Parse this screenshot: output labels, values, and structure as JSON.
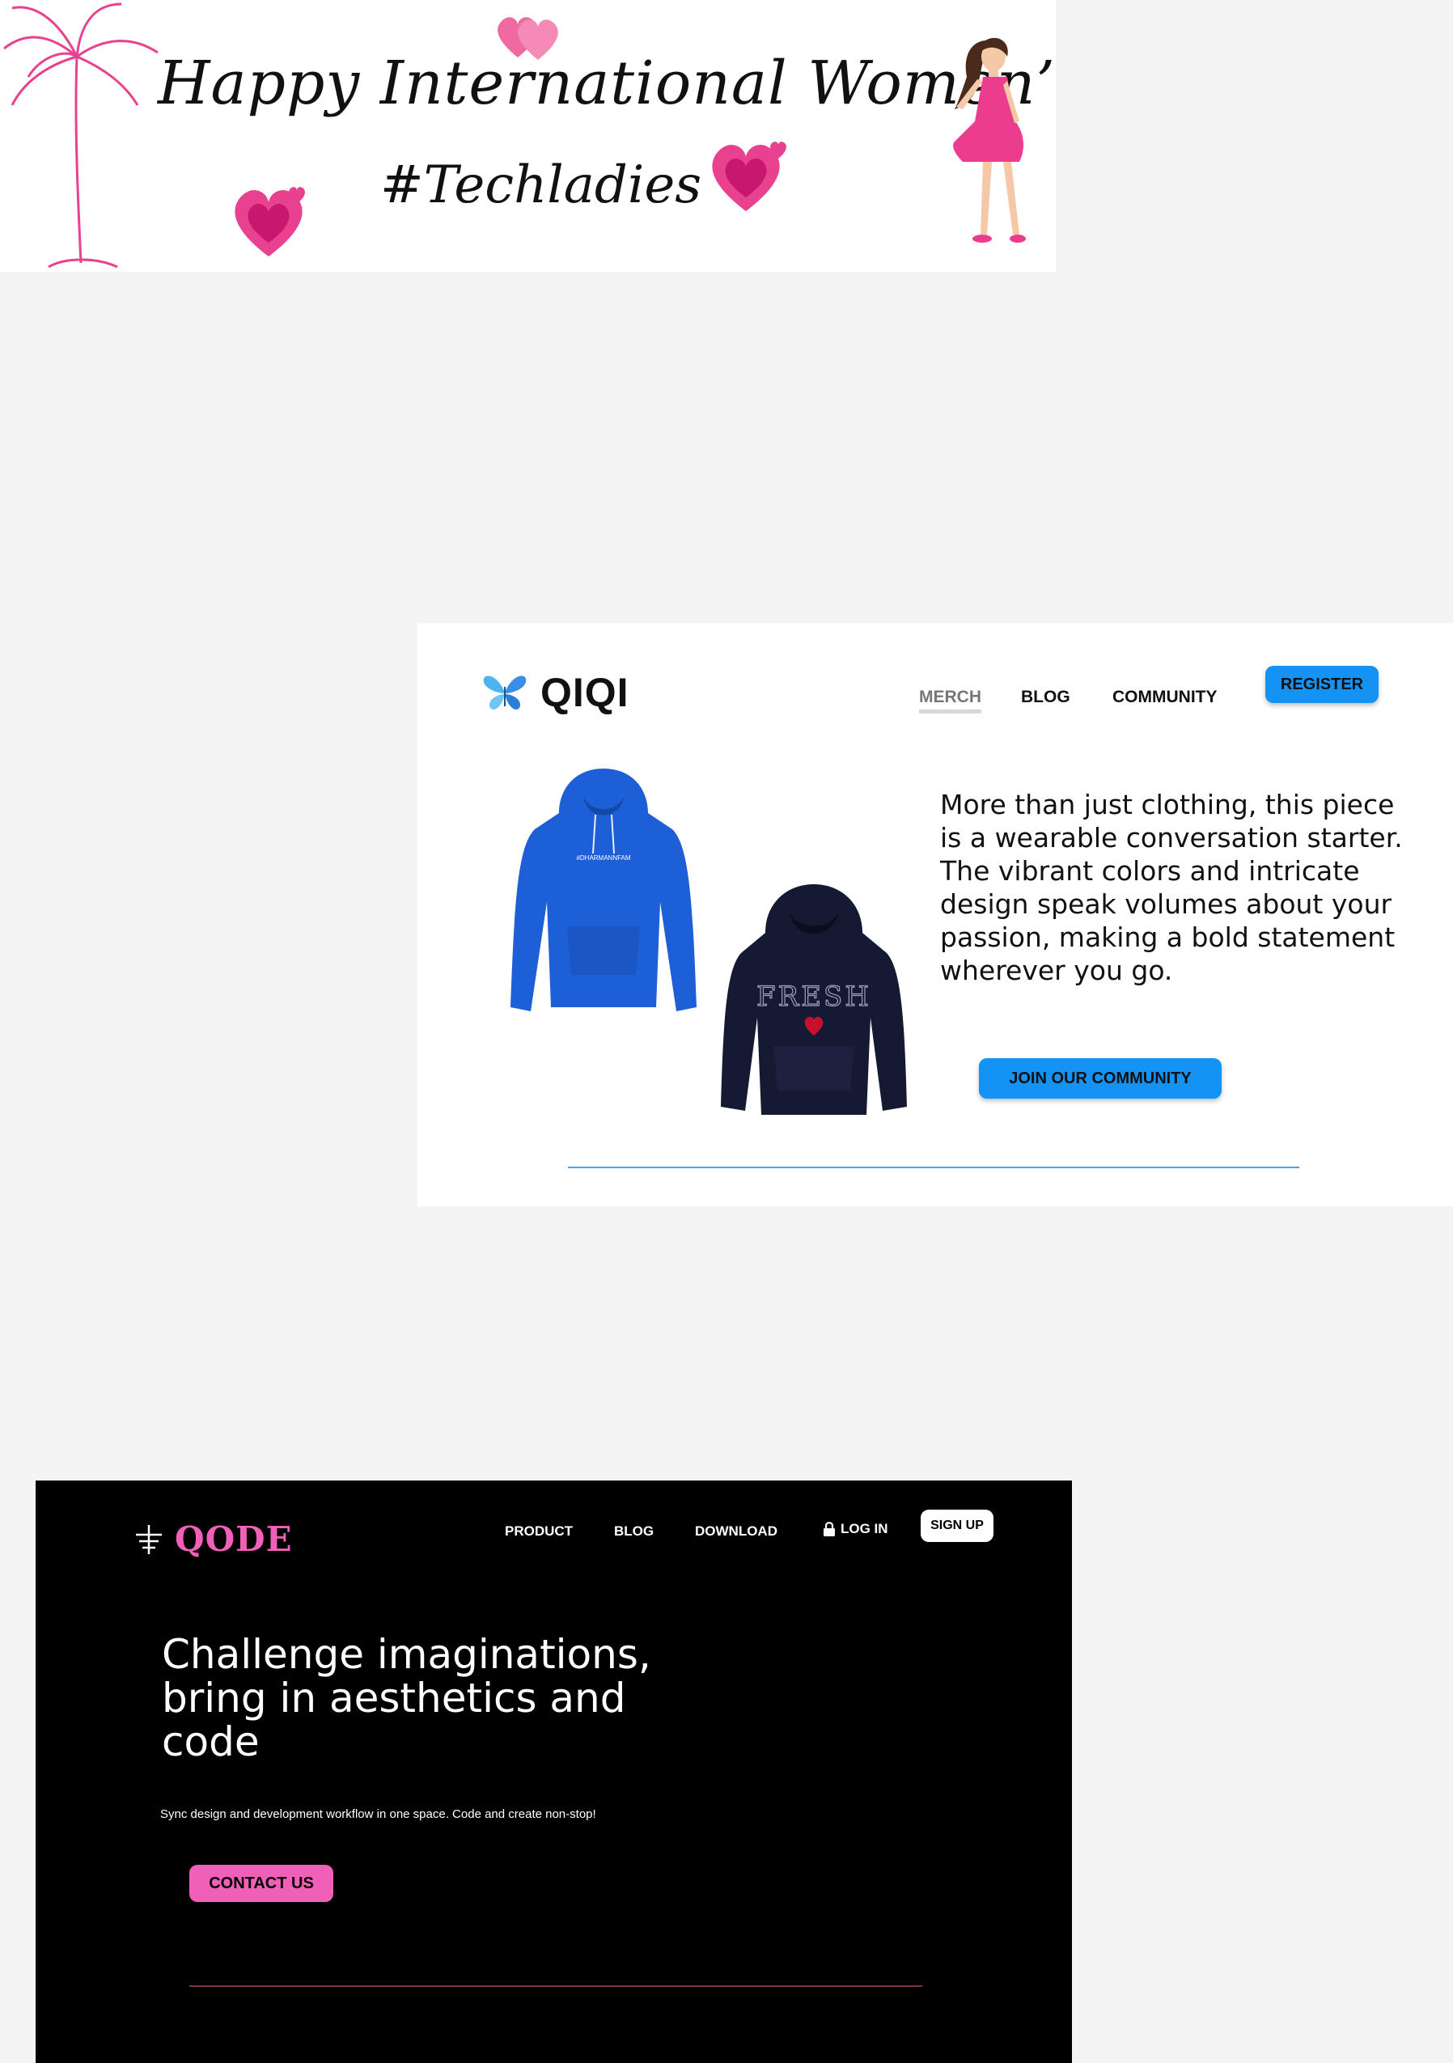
{
  "banner": {
    "title": "Happy International Women’s Day",
    "hashtag": "#Techladies"
  },
  "qiqi": {
    "brand": "QIQI",
    "nav": {
      "merch": "MERCH",
      "blog": "BLOG",
      "community": "COMMUNITY"
    },
    "register_label": "REGISTER",
    "description": "More than just clothing, this piece is a wearable conversation starter. The vibrant colors and intricate design speak volumes about your passion, making a bold statement wherever you go.",
    "join_label": "JOIN OUR COMMUNITY",
    "blue_hoodie_text": "#DHARMANNFAM",
    "navy_hoodie_text": "FRESH",
    "colors": {
      "accent": "#1493f5"
    }
  },
  "qode": {
    "brand": "QODE",
    "nav": {
      "product": "PRODUCT",
      "blog": "BLOG",
      "download": "DOWNLOAD",
      "login": "LOG IN"
    },
    "signup_label": "SIGN UP",
    "headline": "Challenge imaginations, bring in aesthetics and code",
    "subtext": "Sync design and development workflow in one space. Code and create non-stop!",
    "contact_label": "CONTACT US",
    "colors": {
      "accent": "#f060b8",
      "background": "#000000"
    }
  }
}
